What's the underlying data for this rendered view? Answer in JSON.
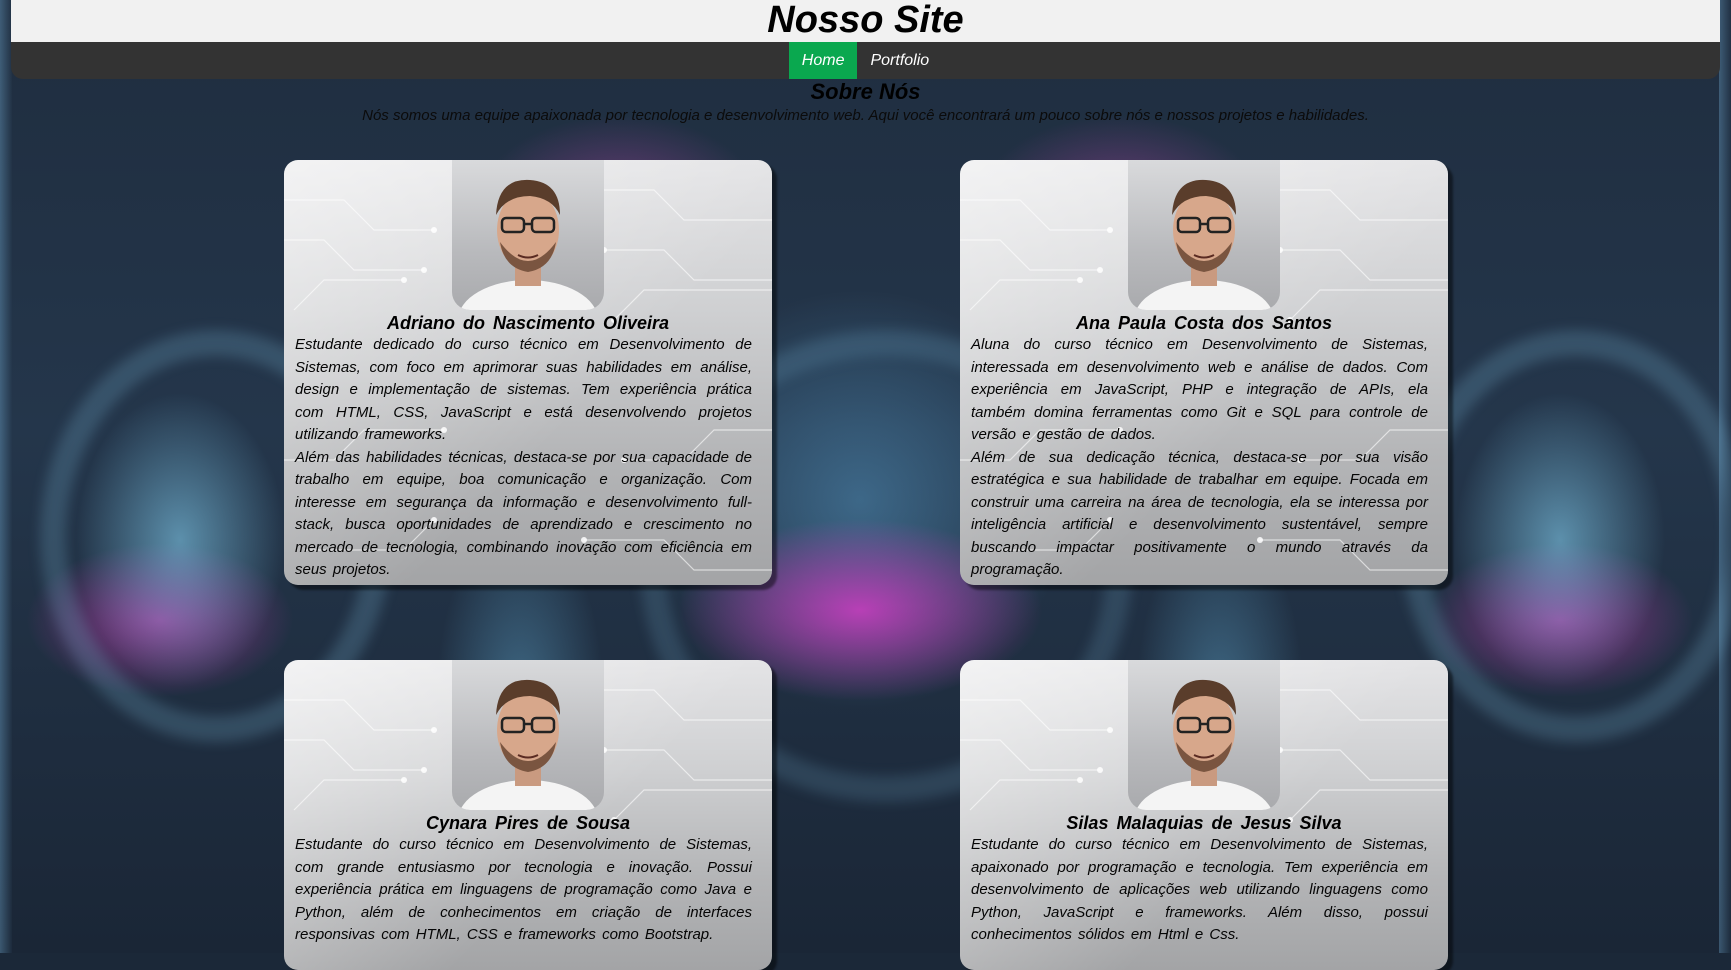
{
  "site": {
    "title": "Nosso Site"
  },
  "nav": {
    "items": [
      {
        "label": "Home",
        "active": true
      },
      {
        "label": "Portfolio",
        "active": false
      }
    ]
  },
  "about": {
    "title": "Sobre Nós",
    "description": "Nós somos uma equipe apaixonada por tecnologia e desenvolvimento web. Aqui você encontrará um pouco sobre nós e nossos projetos e habilidades."
  },
  "members": [
    {
      "name": "Adriano do Nascimento Oliveira",
      "bio1": "Estudante dedicado do curso técnico em Desenvolvimento de Sistemas, com foco em aprimorar suas habilidades em análise, design e implementação de sistemas. Tem experiência prática com HTML, CSS, JavaScript e está desenvolvendo projetos utilizando frameworks.",
      "bio2": "Além das habilidades técnicas, destaca-se por sua capacidade de trabalho em equipe, boa comunicação e organização. Com interesse em segurança da informação e desenvolvimento full-stack, busca oportunidades de aprendizado e crescimento no mercado de tecnologia, combinando inovação com eficiência em seus projetos."
    },
    {
      "name": "Ana Paula Costa dos Santos",
      "bio1": "Aluna do curso técnico em Desenvolvimento de Sistemas, interessada em desenvolvimento web e análise de dados. Com experiência em JavaScript, PHP e integração de APIs, ela também domina ferramentas como Git e SQL para controle de versão e gestão de dados.",
      "bio2": "Além de sua dedicação técnica, destaca-se por sua visão estratégica e sua habilidade de trabalhar em equipe. Focada em construir uma carreira na área de tecnologia, ela se interessa por inteligência artificial e desenvolvimento sustentável, sempre buscando impactar positivamente o mundo através da programação."
    },
    {
      "name": "Cynara Pires de Sousa",
      "bio1": "Estudante do curso técnico em Desenvolvimento de Sistemas, com grande entusiasmo por tecnologia e inovação. Possui experiência prática em linguagens de programação como Java e Python, além de conhecimentos em criação de interfaces responsivas com HTML, CSS e frameworks como Bootstrap.",
      "bio2": ""
    },
    {
      "name": "Silas Malaquias de Jesus Silva",
      "bio1": "Estudante do curso técnico em Desenvolvimento de Sistemas, apaixonado por programação e tecnologia. Tem experiência em desenvolvimento de aplicações web utilizando linguagens como Python, JavaScript e frameworks. Além disso, possui conhecimentos sólidos em Html e Css.",
      "bio2": ""
    }
  ]
}
